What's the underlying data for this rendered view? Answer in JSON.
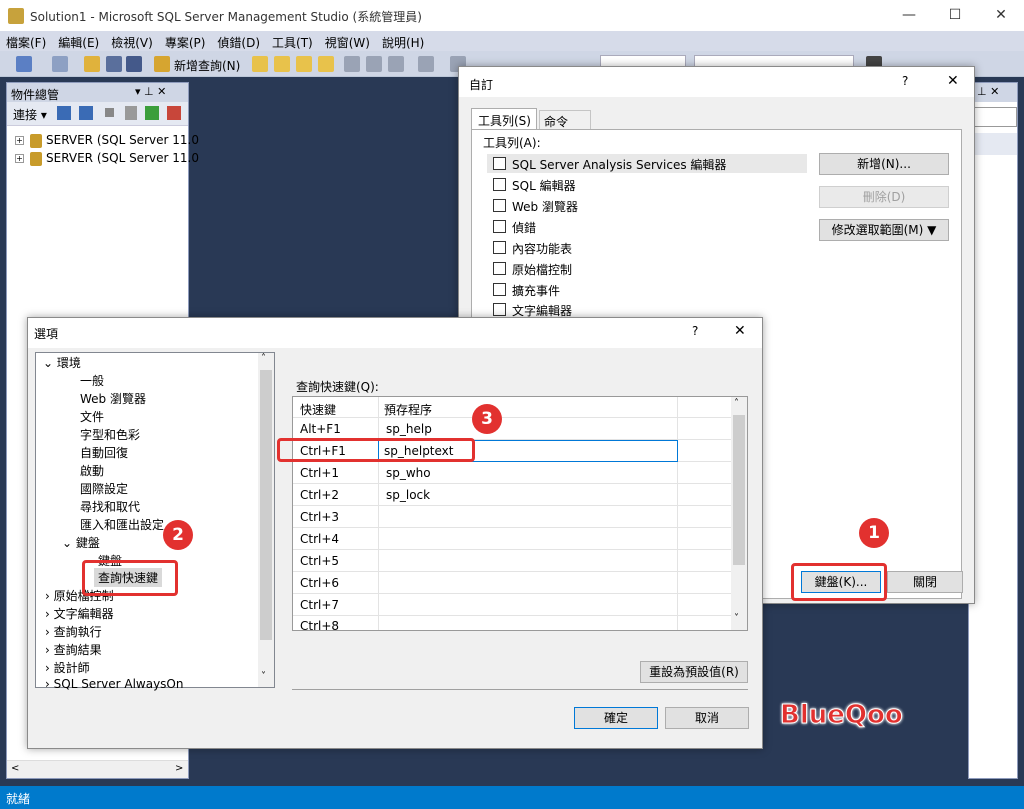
{
  "window": {
    "title": "Solution1 - Microsoft SQL Server Management Studio (系統管理員)",
    "minimize": "—",
    "maximize": "☐",
    "close": "✕"
  },
  "menu": [
    "檔案(F)",
    "編輯(E)",
    "檢視(V)",
    "專案(P)",
    "偵錯(D)",
    "工具(T)",
    "視窗(W)",
    "說明(H)"
  ],
  "toolbar": {
    "new_query": "新增查詢(N)"
  },
  "object_explorer": {
    "title": "物件總管",
    "pin": "▾ ⊥ ✕",
    "connect": "連接 ▾",
    "servers": [
      "SERVER (SQL Server 11.0",
      "SERVER (SQL Server 11.0"
    ]
  },
  "customize": {
    "title": "自訂",
    "help": "?",
    "close": "✕",
    "tabs": [
      "工具列(S)",
      "命令(O)"
    ],
    "list_label": "工具列(A):",
    "toolbars": [
      "SQL Server Analysis Services 編輯器",
      "SQL 編輯器",
      "Web 瀏覽器",
      "偵錯",
      "內容功能表",
      "原始檔控制",
      "擴充事件",
      "文字編輯器"
    ],
    "new_button": "新增(N)...",
    "delete_button": "刪除(D)",
    "modify_button": "修改選取範圍(M) ▼",
    "keyboard_button": "鍵盤(K)...",
    "close_button": "關閉"
  },
  "options": {
    "title": "選項",
    "help": "?",
    "close": "✕",
    "tree": {
      "environment": "環境",
      "env_children": [
        "一般",
        "Web 瀏覽器",
        "文件",
        "字型和色彩",
        "自動回復",
        "啟動",
        "國際設定",
        "尋找和取代",
        "匯入和匯出設定"
      ],
      "keyboard": "鍵盤",
      "keyboard_children": [
        "鍵盤",
        "查詢快速鍵"
      ],
      "others": [
        "原始檔控制",
        "文字編輯器",
        "查詢執行",
        "查詢結果",
        "設計師",
        "SQL Server AlwaysOn"
      ]
    },
    "grid_label": "查詢快速鍵(Q):",
    "col_shortcut": "快速鍵",
    "col_procedure": "預存程序",
    "rows": [
      {
        "key": "Alt+F1",
        "proc": "sp_help"
      },
      {
        "key": "Ctrl+F1",
        "proc": "sp_helptext"
      },
      {
        "key": "Ctrl+1",
        "proc": "sp_who"
      },
      {
        "key": "Ctrl+2",
        "proc": "sp_lock"
      },
      {
        "key": "Ctrl+3",
        "proc": ""
      },
      {
        "key": "Ctrl+4",
        "proc": ""
      },
      {
        "key": "Ctrl+5",
        "proc": ""
      },
      {
        "key": "Ctrl+6",
        "proc": ""
      },
      {
        "key": "Ctrl+7",
        "proc": ""
      },
      {
        "key": "Ctrl+8",
        "proc": ""
      }
    ],
    "reset_button": "重設為預設值(R)",
    "ok_button": "確定",
    "cancel_button": "取消"
  },
  "annotations": {
    "badge1": "1",
    "badge2": "2",
    "badge3": "3",
    "watermark": "BlueQoo"
  },
  "status": "就緒",
  "colors": {
    "accent": "#007acc",
    "highlight": "#e2312f",
    "background": "#293955"
  }
}
